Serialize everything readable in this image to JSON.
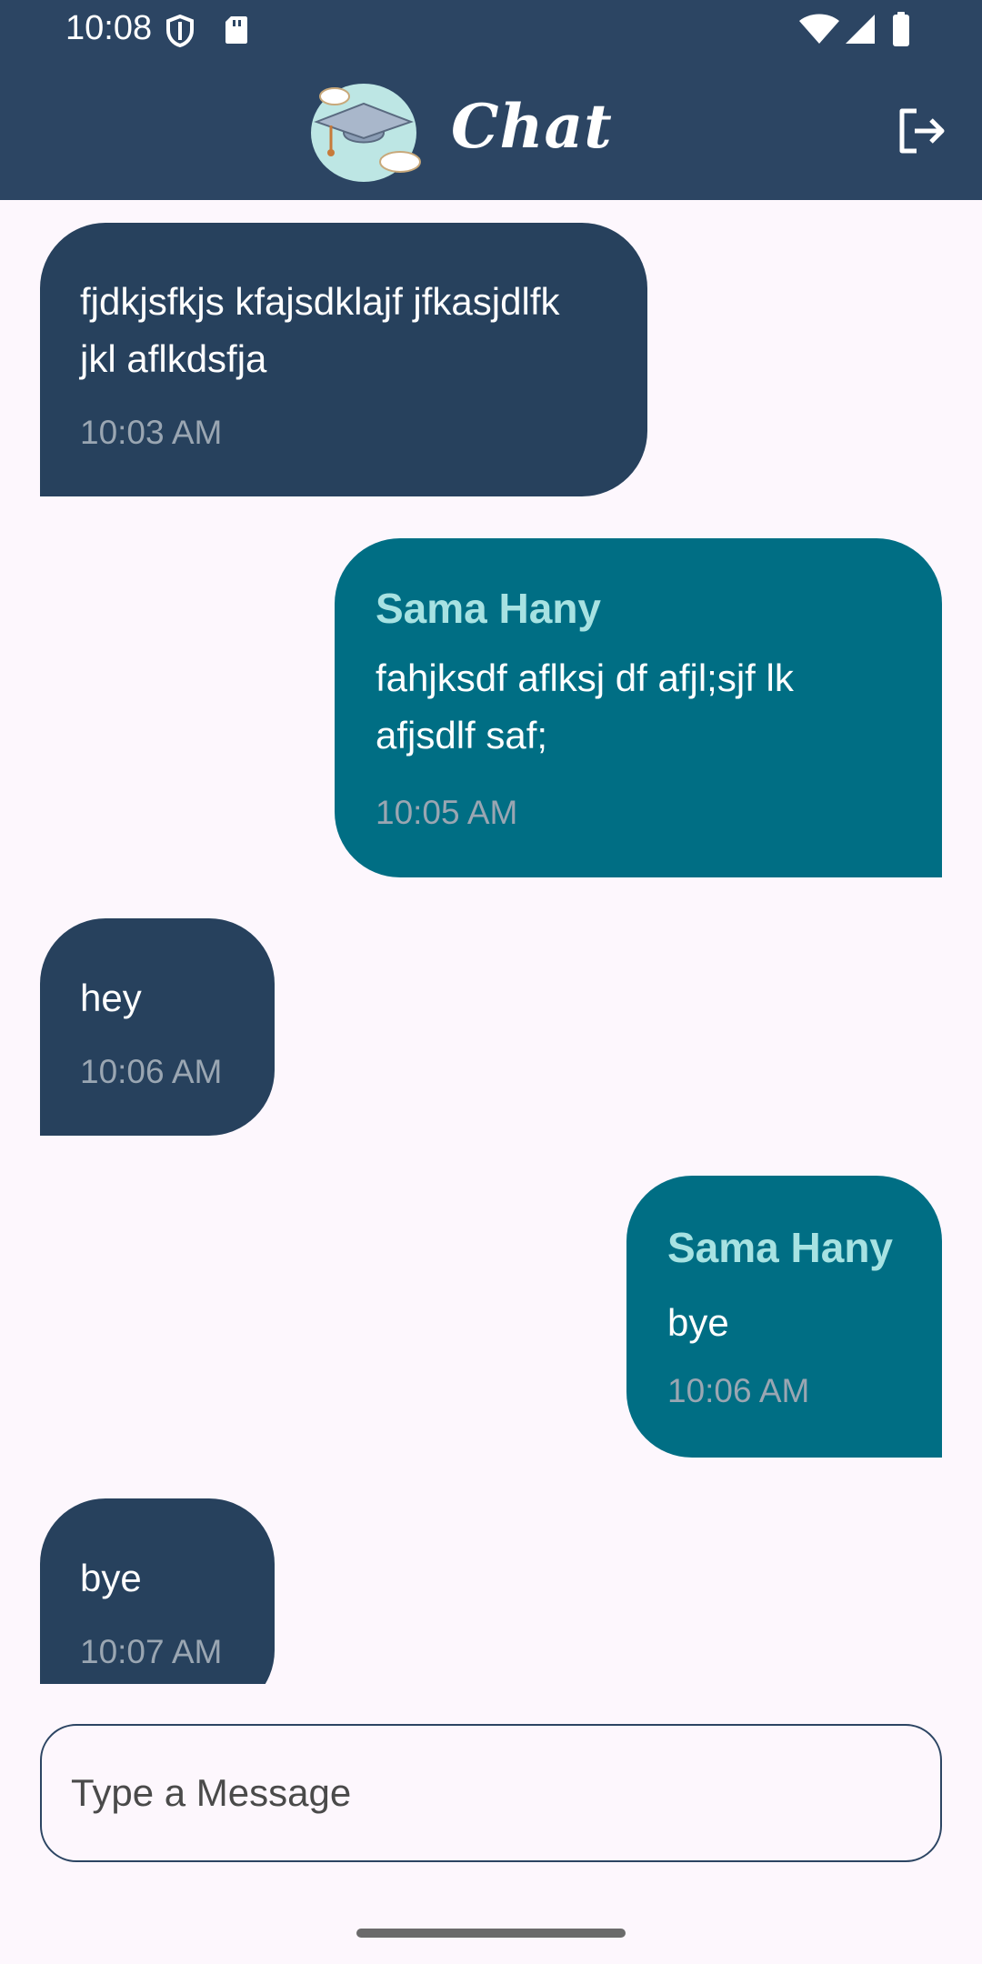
{
  "status_bar": {
    "time": "10:08",
    "icons": [
      "shield-icon",
      "sd-card-icon",
      "wifi-icon",
      "signal-icon",
      "battery-icon"
    ]
  },
  "app_bar": {
    "title": "Chat",
    "logo_icon": "graduation-cap-cloud-logo",
    "logout_icon": "logout-icon",
    "background_color": "#2C4563"
  },
  "messages": [
    {
      "direction": "received",
      "sender": "",
      "text": "fjdkjsfkjs kfajsdklajf jfkasjdlfk jkl aflkdsfja",
      "time": "10:03 AM"
    },
    {
      "direction": "sent",
      "sender": "Sama Hany",
      "text": "fahjksdf aflksj df afjl;sjf lk afjsdlf saf;",
      "time": "10:05 AM"
    },
    {
      "direction": "received",
      "sender": "",
      "text": "hey",
      "time": "10:06 AM"
    },
    {
      "direction": "sent",
      "sender": "Sama Hany",
      "text": "bye",
      "time": "10:06 AM"
    },
    {
      "direction": "received",
      "sender": "",
      "text": "bye",
      "time": "10:07 AM"
    }
  ],
  "colors": {
    "received_bubble": "#27415D",
    "sent_bubble": "#006E84",
    "sender_name": "#A7E2E2",
    "page_background": "#FDF7FD"
  },
  "composer": {
    "placeholder": "Type a Message",
    "value": ""
  }
}
